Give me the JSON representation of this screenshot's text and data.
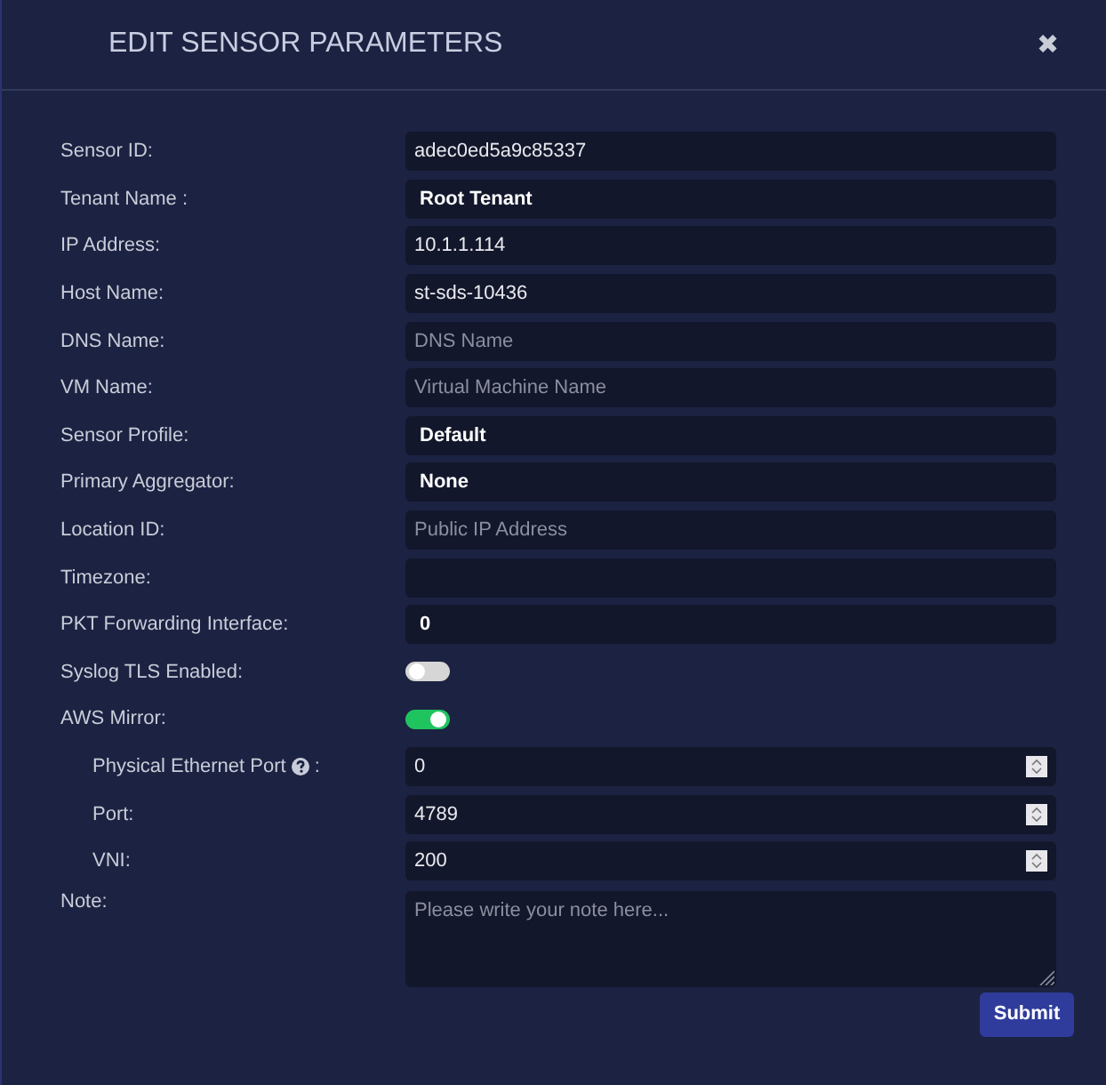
{
  "dialog": {
    "title": "EDIT SENSOR PARAMETERS",
    "close_glyph": "✖"
  },
  "fields": [
    {
      "label": "Sensor ID:",
      "kind": "text",
      "value": "adec0ed5a9c85337"
    },
    {
      "label": "Tenant Name :",
      "kind": "select",
      "value": "Root Tenant"
    },
    {
      "label": "IP Address:",
      "kind": "text",
      "value": "10.1.1.114"
    },
    {
      "label": "Host Name:",
      "kind": "text",
      "value": "st-sds-10436"
    },
    {
      "label": "DNS Name:",
      "kind": "text",
      "placeholder": "DNS Name"
    },
    {
      "label": "VM Name:",
      "kind": "text",
      "placeholder": "Virtual Machine Name"
    },
    {
      "label": "Sensor Profile:",
      "kind": "select",
      "value": "Default"
    },
    {
      "label": "Primary Aggregator:",
      "kind": "select",
      "value": "None"
    },
    {
      "label": "Location ID:",
      "kind": "text",
      "placeholder": "Public IP Address"
    },
    {
      "label": "Timezone:",
      "kind": "text"
    },
    {
      "label": "PKT Forwarding Interface:",
      "kind": "select",
      "value": "0"
    },
    {
      "label": "Syslog TLS Enabled:",
      "kind": "toggle",
      "on": false
    },
    {
      "label": "AWS Mirror:",
      "kind": "toggle",
      "on": true,
      "children": [
        {
          "label": "Physical Ethernet Port",
          "help": true,
          "label_suffix": ":",
          "kind": "number",
          "value": "0"
        },
        {
          "label": "Port:",
          "kind": "number",
          "value": "4789"
        },
        {
          "label": "VNI:",
          "kind": "number",
          "value": "200"
        }
      ]
    },
    {
      "label": "Note:",
      "kind": "textarea",
      "placeholder": "Please write your note here..."
    }
  ],
  "submit": "Submit"
}
